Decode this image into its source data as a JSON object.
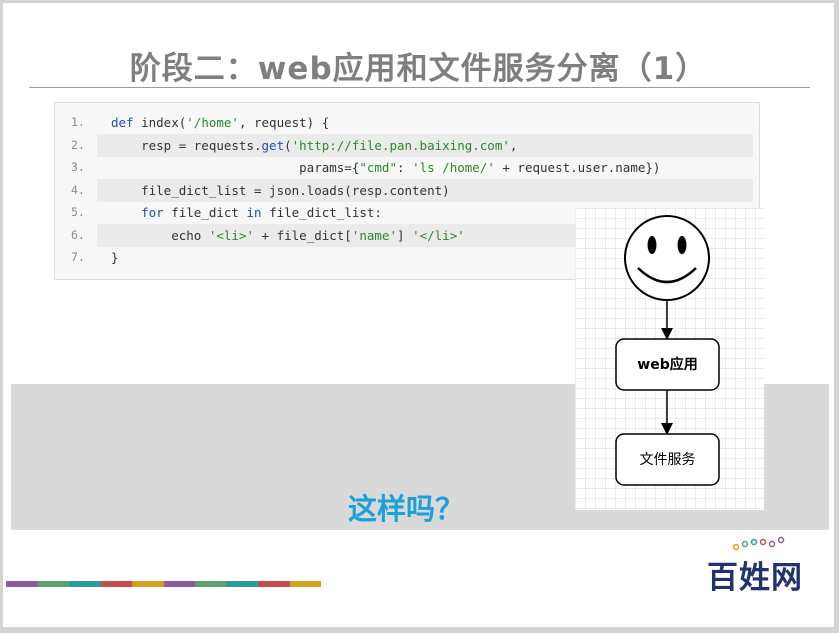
{
  "slide": {
    "title": "阶段二：web应用和文件服务分离（1）",
    "question": "这样吗？"
  },
  "code": {
    "lines": [
      {
        "num": "1.",
        "segments": [
          {
            "t": "def",
            "c": "kw"
          },
          {
            "t": " index(",
            "c": "pn"
          },
          {
            "t": "'/home'",
            "c": "str"
          },
          {
            "t": ", request) {",
            "c": "pn"
          }
        ]
      },
      {
        "num": "2.",
        "segments": [
          {
            "t": "    resp = requests.",
            "c": "pn"
          },
          {
            "t": "get",
            "c": "kw"
          },
          {
            "t": "(",
            "c": "pn"
          },
          {
            "t": "'http://file.pan.baixing.com'",
            "c": "str"
          },
          {
            "t": ",",
            "c": "pn"
          }
        ]
      },
      {
        "num": "3.",
        "segments": [
          {
            "t": "                         params={",
            "c": "pn"
          },
          {
            "t": "\"cmd\"",
            "c": "str"
          },
          {
            "t": ": ",
            "c": "pn"
          },
          {
            "t": "'ls /home/'",
            "c": "str"
          },
          {
            "t": " + request.user.name})",
            "c": "pn"
          }
        ]
      },
      {
        "num": "4.",
        "segments": [
          {
            "t": "    file_dict_list = json.loads(resp.content)",
            "c": "pn"
          }
        ]
      },
      {
        "num": "5.",
        "segments": [
          {
            "t": "    ",
            "c": "pn"
          },
          {
            "t": "for",
            "c": "kw"
          },
          {
            "t": " file_dict ",
            "c": "pn"
          },
          {
            "t": "in",
            "c": "kw"
          },
          {
            "t": " file_dict_list:",
            "c": "pn"
          }
        ]
      },
      {
        "num": "6.",
        "segments": [
          {
            "t": "        echo ",
            "c": "pn"
          },
          {
            "t": "'<li>'",
            "c": "str"
          },
          {
            "t": " + file_dict[",
            "c": "pn"
          },
          {
            "t": "'name'",
            "c": "str"
          },
          {
            "t": "] ",
            "c": "pn"
          },
          {
            "t": "'</li>'",
            "c": "str"
          }
        ]
      },
      {
        "num": "7.",
        "segments": [
          {
            "t": "}",
            "c": "pn"
          }
        ]
      }
    ]
  },
  "diagram": {
    "node_web": "web应用",
    "node_file": "文件服务",
    "actor_icon": "smiley-face-icon"
  },
  "logo": {
    "text": "百姓网"
  },
  "stripe_colors": [
    "#8e5a9e",
    "#5aa469",
    "#2e9aa6",
    "#c0504d",
    "#d6a21e",
    "#8e5a9e",
    "#5aa469",
    "#2e9aa6",
    "#c0504d",
    "#d6a21e"
  ],
  "colors": {
    "title": "#7f7f7f",
    "question": "#1ca0d8",
    "logo": "#22316f"
  }
}
